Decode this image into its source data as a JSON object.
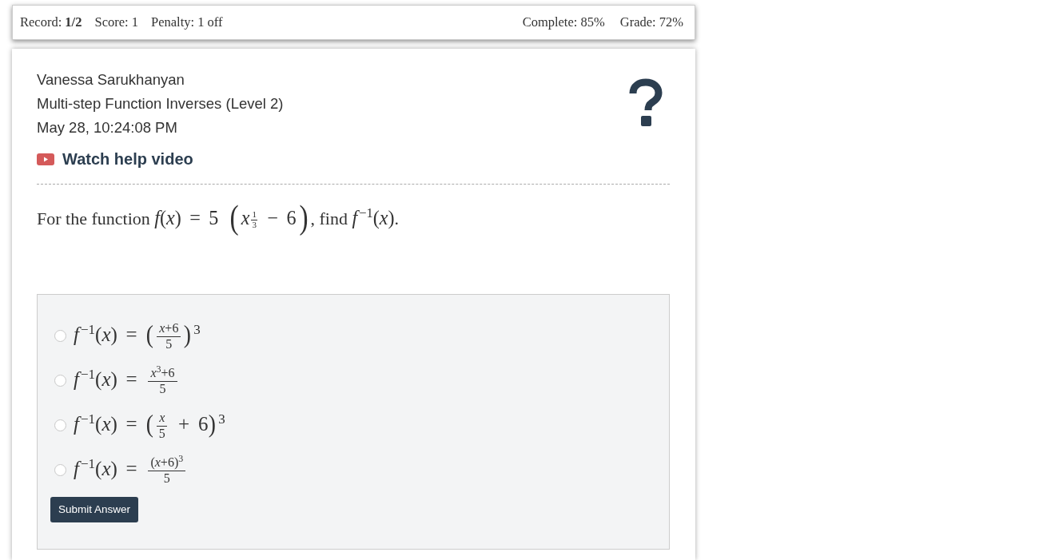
{
  "stats_bar": {
    "left": [
      "Record: **1/2**",
      "Score: 1",
      "Penalty: 1 off"
    ],
    "right": [
      "Complete: 85%",
      "Grade: 72%"
    ]
  },
  "header": {
    "student": "Vanessa Sarukhanyan",
    "assignment": "Multi-step Function Inverses (Level 2)",
    "timestamp": "May 28, 10:24:08 PM",
    "help_video_link": "Watch help video"
  },
  "question": {
    "parts": [
      {
        "kind": "text",
        "text": "For the function "
      },
      {
        "kind": "math",
        "text": "*f*(*x*) = 5 "
      },
      {
        "kind": "paren",
        "text": "("
      },
      {
        "kind": "math",
        "text": "*x*"
      },
      {
        "kind": "supfrac",
        "num": "1",
        "den": "3"
      },
      {
        "kind": "math",
        "text": " − 6"
      },
      {
        "kind": "paren",
        "text": ")"
      },
      {
        "kind": "text",
        "text": ", find "
      },
      {
        "kind": "math",
        "text": "*f*$^{−1}$(*x*)"
      },
      {
        "kind": "text",
        "text": "."
      }
    ]
  },
  "answers": {
    "options": [
      {
        "selected": false,
        "parts": [
          {
            "kind": "math",
            "text": "*f*$^{−1}$(*x*) = "
          },
          {
            "kind": "paren",
            "text": "("
          },
          {
            "kind": "frac",
            "num": "*x*+6",
            "den": "5"
          },
          {
            "kind": "paren",
            "text": ")"
          },
          {
            "kind": "sup",
            "text": "3"
          }
        ]
      },
      {
        "selected": false,
        "parts": [
          {
            "kind": "math",
            "text": "*f*$^{−1}$(*x*) = "
          },
          {
            "kind": "frac",
            "num": "*x*$^{3}$+6",
            "den": "5"
          }
        ]
      },
      {
        "selected": false,
        "parts": [
          {
            "kind": "math",
            "text": "*f*$^{−1}$(*x*) = "
          },
          {
            "kind": "paren",
            "text": "("
          },
          {
            "kind": "frac",
            "num": "*x*",
            "den": "5"
          },
          {
            "kind": "math",
            "text": " + 6"
          },
          {
            "kind": "paren",
            "text": ")"
          },
          {
            "kind": "sup",
            "text": "3"
          }
        ]
      },
      {
        "selected": false,
        "parts": [
          {
            "kind": "math",
            "text": "*f*$^{−1}$(*x*) = "
          },
          {
            "kind": "frac",
            "num": "(*x*+6)$^{3}$",
            "den": "5"
          }
        ]
      }
    ],
    "submit_button": "Submit Answer"
  }
}
